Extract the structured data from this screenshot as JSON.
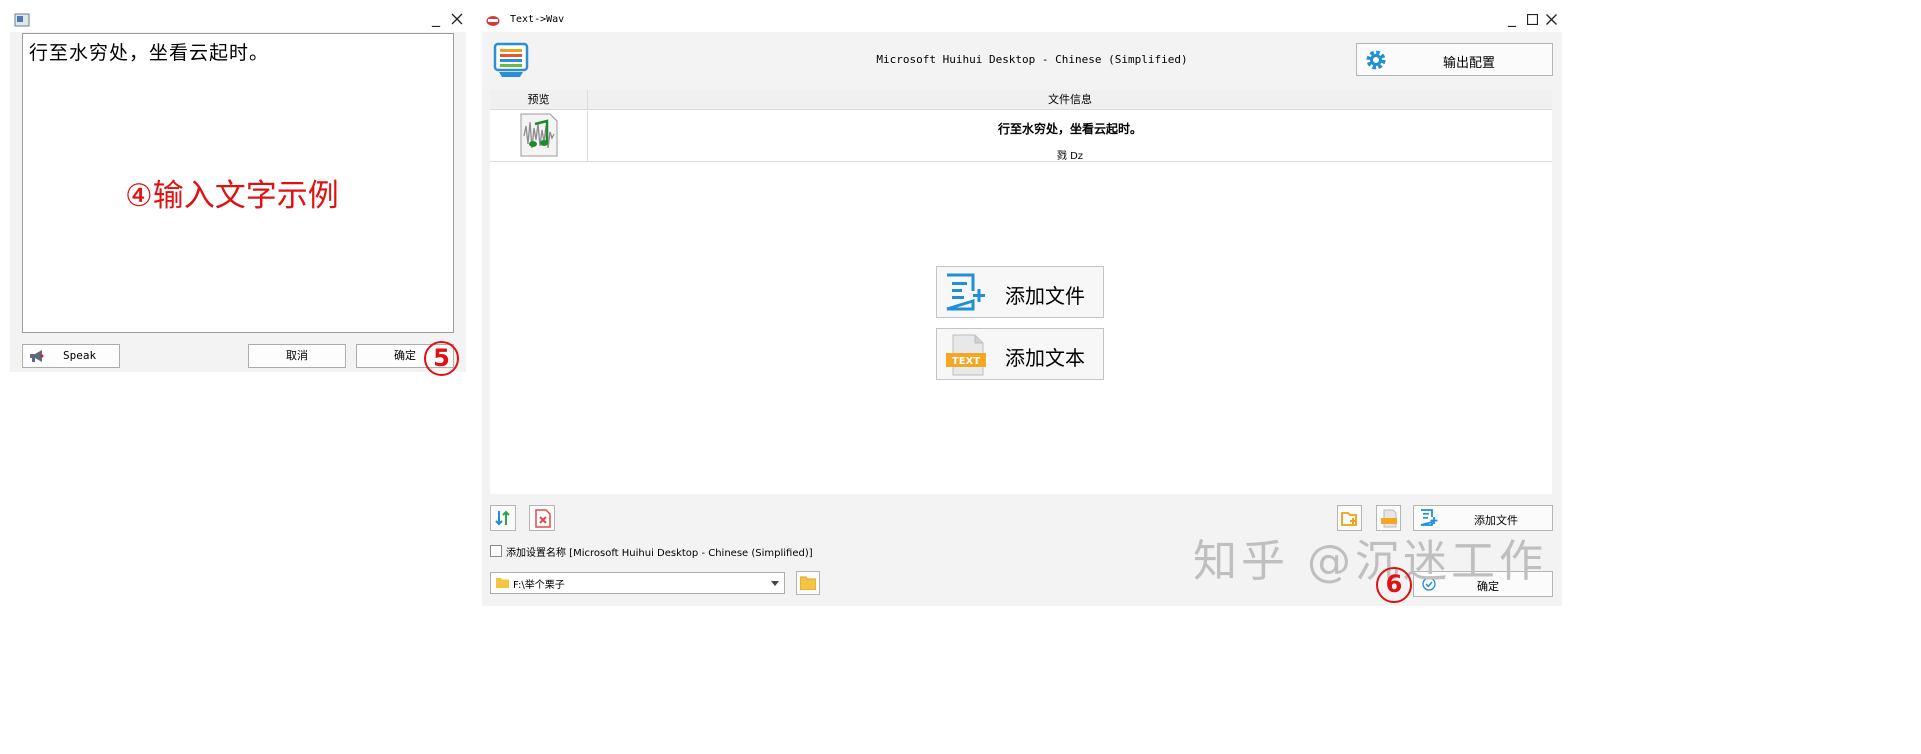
{
  "left_window": {
    "text_content": "行至水穷处，坐看云起时。",
    "annotation_label": "④输入文字示例",
    "speak_label": "Speak",
    "cancel_label": "取消",
    "confirm_label": "确定",
    "step_marker": "5"
  },
  "right_window": {
    "title": "Text->Wav",
    "voice_name": "Microsoft Huihui Desktop - Chinese (Simplified)",
    "output_config_label": "输出配置",
    "columns": {
      "preview": "预览",
      "file_info": "文件信息"
    },
    "file_rows": [
      {
        "text": "行至水穷处，坐看云起时。",
        "meta": "戮  Dz"
      }
    ],
    "add_file_label": "添加文件",
    "add_text_label": "添加文本",
    "add_file_small_label": "添加文件",
    "checkbox_label": "添加设置名称 [Microsoft Huihui Desktop - Chinese (Simplified)]",
    "path_value": "F:\\举个栗子",
    "ok_label": "确定",
    "step_marker": "6"
  },
  "watermark": "知乎 @沉迷工作",
  "colors": {
    "annotation": "#e01111",
    "accent_blue": "#1f8fd6",
    "text_yellow": "#f5a623"
  }
}
